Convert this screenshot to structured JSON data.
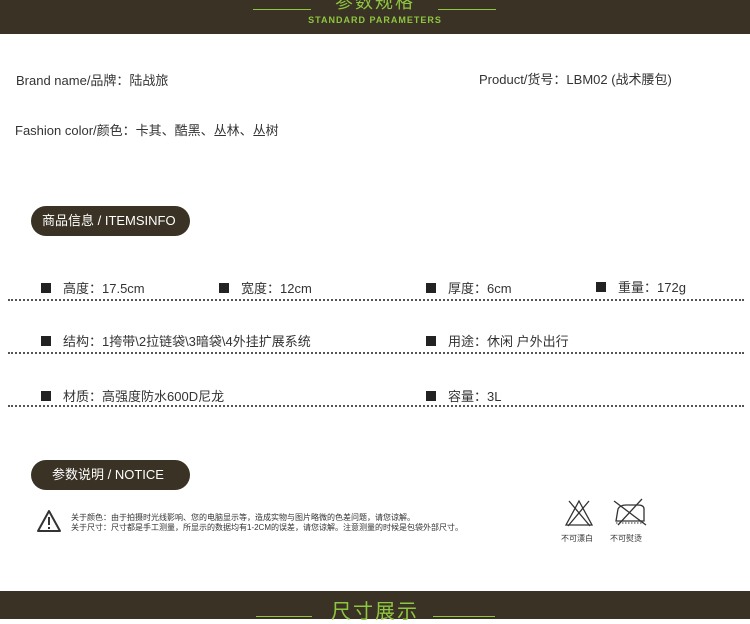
{
  "header": {
    "title_cn": "参数规格",
    "title_en": "STANDARD PARAMETERS"
  },
  "info": {
    "brand": "Brand name/品牌：陆战旅",
    "product": "Product/货号：LBM02 (战术腰包)",
    "color": "Fashion color/颜色：卡其、酷黑、丛林、丛树"
  },
  "items_section": {
    "title": "商品信息 / ITEMSINFO",
    "rows": [
      [
        "高度：17.5cm",
        "宽度：12cm",
        "厚度：6cm",
        "重量：172g"
      ],
      [
        "结构：1挎带\\2拉链袋\\3暗袋\\4外挂扩展系统",
        "用途：休闲 户外出行"
      ],
      [
        "材质：高强度防水600D尼龙",
        "容量：3L"
      ]
    ]
  },
  "notice_section": {
    "title": "参数说明 / NOTICE",
    "line1": "关于颜色：由于拍摄时光线影响、您的电脑显示等，造成实物与图片略微的色差问题，请您谅解。",
    "line2": "关于尺寸：尺寸都是手工测量，所显示的数据均有1-2CM的误差，请您谅解。注意测量的时候是包袋外部尺寸。",
    "care": [
      {
        "icon": "no-bleach-icon",
        "label": "不可漂白"
      },
      {
        "icon": "no-iron-icon",
        "label": "不可熨烫"
      }
    ]
  },
  "footer": {
    "title_cn": "尺寸展示"
  },
  "colors": {
    "band": "#3a3325",
    "accent": "#8ec63f"
  }
}
